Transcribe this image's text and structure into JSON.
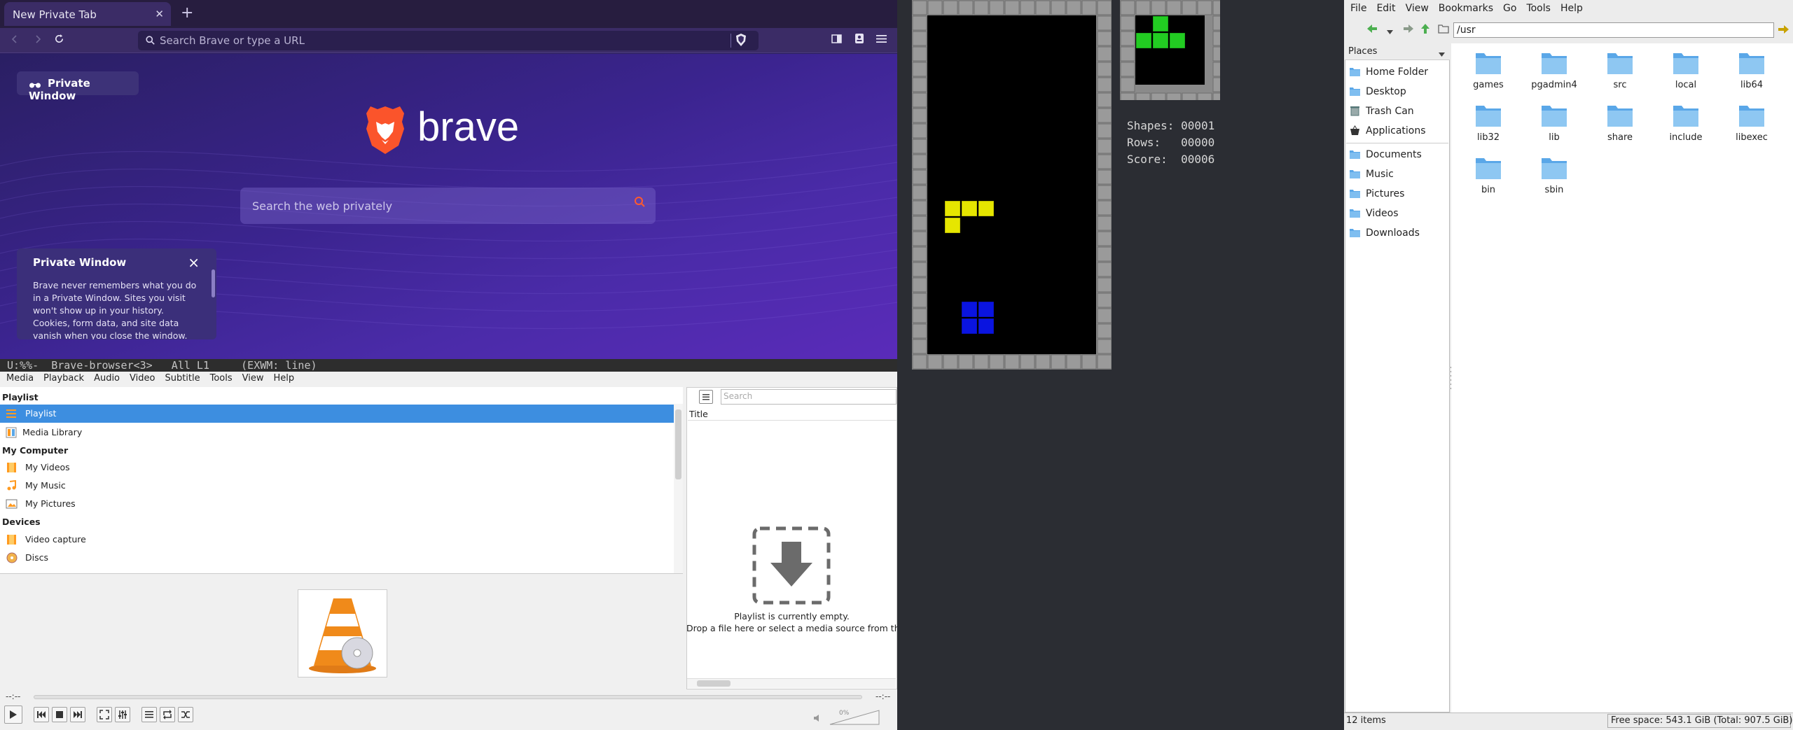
{
  "brave": {
    "tab_title": "New Private Tab",
    "tab_close": "✕",
    "new_tab": "+",
    "url_placeholder": "Search Brave or type a URL",
    "private_badge": "Private Window",
    "brand": "brave",
    "search_placeholder": "Search the web privately",
    "card_title": "Private Window",
    "card_text": "Brave never remembers what you do in a Private Window. Sites you visit won't show up in your history. Cookies, form data, and site data vanish when you close the window. Note that your"
  },
  "modeline": {
    "text": "U:%%-  Brave-browser<3>   All L1     (EXWM: line)"
  },
  "vlc": {
    "menu": [
      "Media",
      "Playback",
      "Audio",
      "Video",
      "Subtitle",
      "Tools",
      "View",
      "Help"
    ],
    "sections": {
      "playlist": "Playlist",
      "my_computer": "My Computer",
      "devices": "Devices"
    },
    "items": {
      "playlist": "Playlist",
      "media_library": "Media Library",
      "my_videos": "My Videos",
      "my_music": "My Music",
      "my_pictures": "My Pictures",
      "video_capture": "Video capture",
      "discs": "Discs"
    },
    "search_placeholder": "Search",
    "column_title": "Title",
    "empty_line1": "Playlist is currently empty.",
    "empty_line2": "Drop a file here or select a media source from the left.",
    "time_elapsed": "--:--",
    "time_total": "--:--",
    "volume": "0%",
    "accent": "#3d8ee0"
  },
  "tetris": {
    "shapes": "Shapes: 00001",
    "rows": "Rows:   00000",
    "score": "Score:  00006",
    "colors": {
      "falling": "#e6e600",
      "next": "#22cc22",
      "settled": "#0a14e0"
    }
  },
  "fm": {
    "menu": [
      "File",
      "Edit",
      "View",
      "Bookmarks",
      "Go",
      "Tools",
      "Help"
    ],
    "path": "/usr",
    "places_label": "Places",
    "places": [
      "Home Folder",
      "Desktop",
      "Trash Can",
      "Applications"
    ],
    "bookmarks": [
      "Documents",
      "Music",
      "Pictures",
      "Videos",
      "Downloads"
    ],
    "files": [
      "games",
      "pgadmin4",
      "src",
      "local",
      "lib64",
      "lib32",
      "lib",
      "share",
      "include",
      "libexec",
      "bin",
      "sbin"
    ],
    "item_count": "12 items",
    "free_space": "Free space: 543.1 GiB (Total: 907.5 GiB)",
    "folder_color": "#5aa7e8"
  }
}
